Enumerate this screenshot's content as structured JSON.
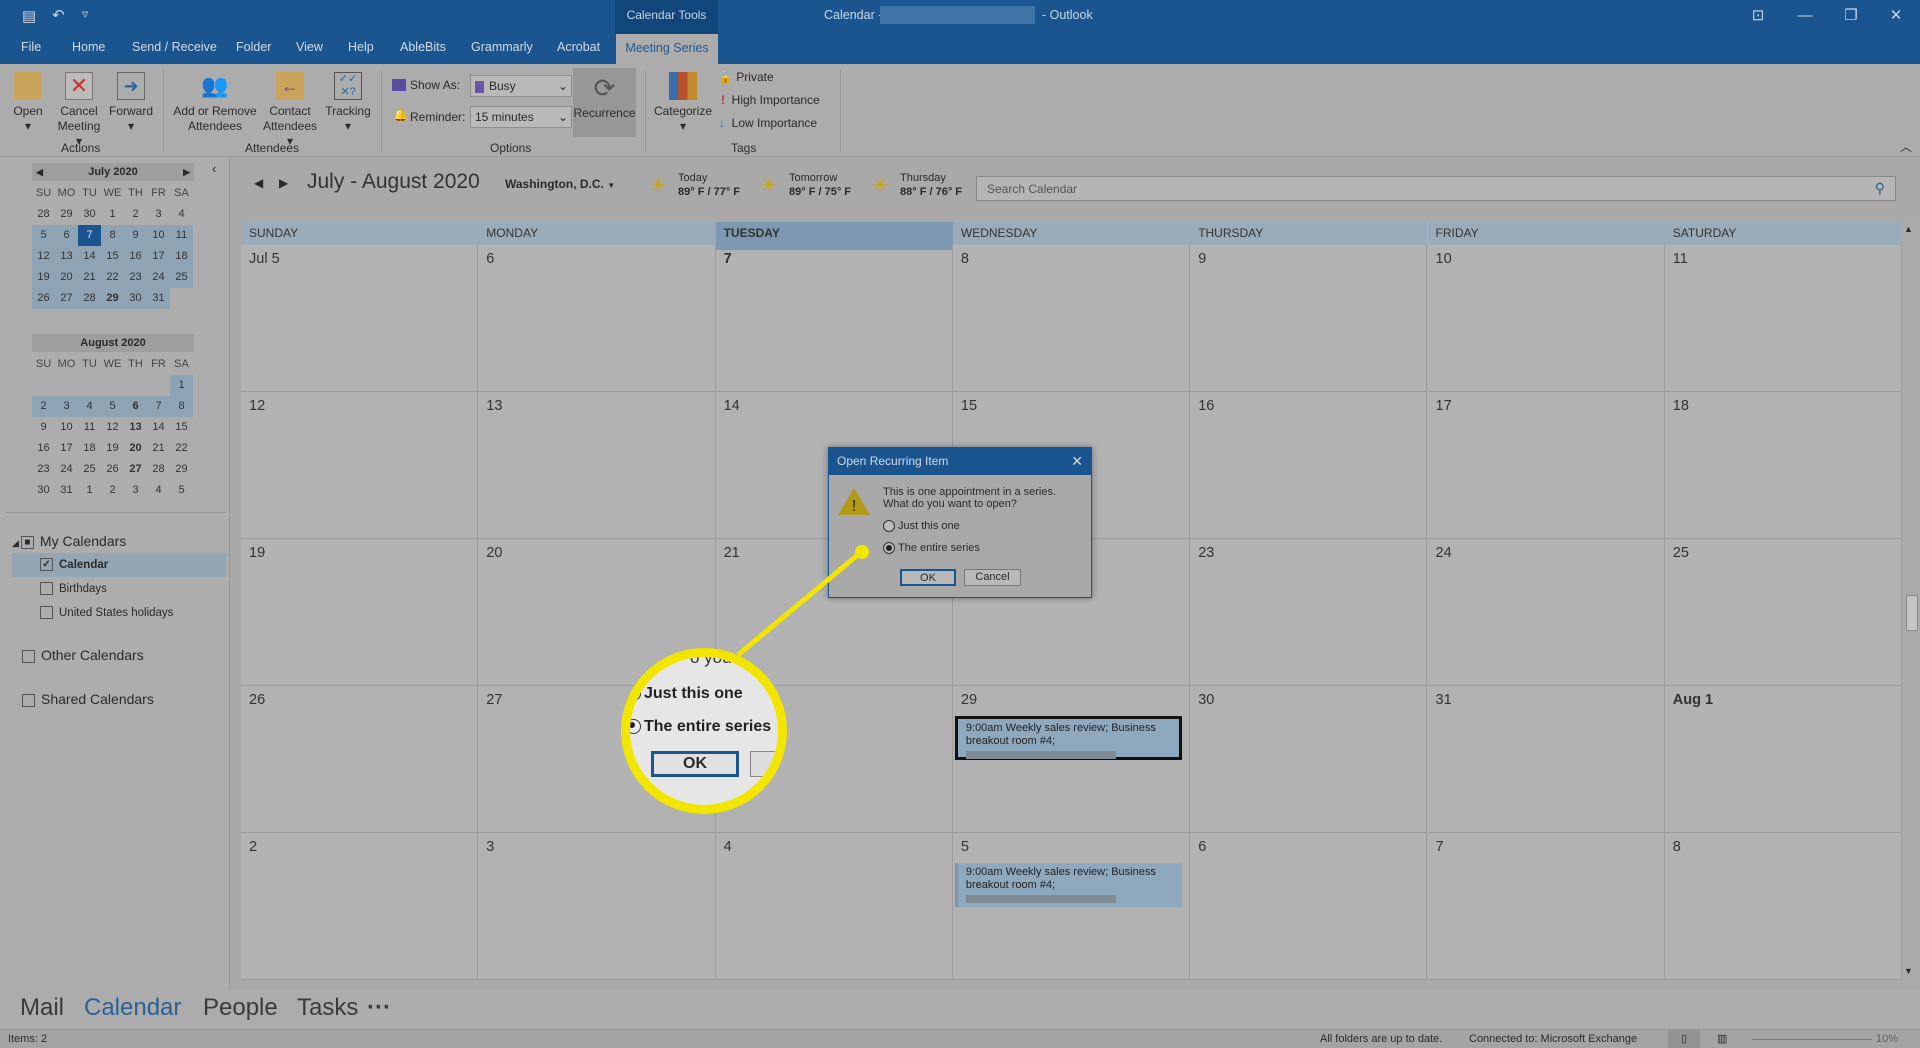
{
  "titlebar": {
    "contextual_tab": "Calendar Tools",
    "title_prefix": "Calendar -",
    "title_suffix": "- Outlook"
  },
  "tabs": [
    "File",
    "Home",
    "Send / Receive",
    "Folder",
    "View",
    "Help",
    "AbleBits",
    "Grammarly",
    "Acrobat",
    "Meeting Series"
  ],
  "ribbon": {
    "actions": {
      "open": "Open",
      "cancel1": "Cancel",
      "cancel2": "Meeting",
      "forward": "Forward",
      "group": "Actions"
    },
    "attendees": {
      "add1": "Add or Remove",
      "add2": "Attendees",
      "contact1": "Contact",
      "contact2": "Attendees",
      "tracking": "Tracking",
      "group": "Attendees"
    },
    "options": {
      "show_as_label": "Show As:",
      "show_as_value": "Busy",
      "reminder_label": "Reminder:",
      "reminder_value": "15 minutes",
      "recurrence": "Recurrence",
      "group": "Options"
    },
    "tags": {
      "categorize": "Categorize",
      "private": "Private",
      "high": "High Importance",
      "low": "Low Importance",
      "group": "Tags"
    }
  },
  "mini_calendars": [
    {
      "title": "July 2020",
      "weekdays": [
        "SU",
        "MO",
        "TU",
        "WE",
        "TH",
        "FR",
        "SA"
      ],
      "days": [
        "28",
        "29",
        "30",
        "1",
        "2",
        "3",
        "4",
        "5",
        "6",
        "7",
        "8",
        "9",
        "10",
        "11",
        "12",
        "13",
        "14",
        "15",
        "16",
        "17",
        "18",
        "19",
        "20",
        "21",
        "22",
        "23",
        "24",
        "25",
        "26",
        "27",
        "28",
        "29",
        "30",
        "31"
      ],
      "highlight_from": 7,
      "highlight_to": 33,
      "selected": 9,
      "bold": [
        31
      ]
    },
    {
      "title": "August 2020",
      "weekdays": [
        "SU",
        "MO",
        "TU",
        "WE",
        "TH",
        "FR",
        "SA"
      ],
      "days": [
        "",
        "",
        "",
        "",
        "",
        "",
        "1",
        "2",
        "3",
        "4",
        "5",
        "6",
        "7",
        "8",
        "9",
        "10",
        "11",
        "12",
        "13",
        "14",
        "15",
        "16",
        "17",
        "18",
        "19",
        "20",
        "21",
        "22",
        "23",
        "24",
        "25",
        "26",
        "27",
        "28",
        "29",
        "30",
        "31",
        "1",
        "2",
        "3",
        "4",
        "5"
      ],
      "highlight_from": 6,
      "highlight_to": 13,
      "selected": -1,
      "bold": [
        11,
        18,
        25,
        32
      ]
    }
  ],
  "calendars": {
    "my": "My Calendars",
    "items": [
      {
        "label": "Calendar",
        "checked": true
      },
      {
        "label": "Birthdays",
        "checked": false
      },
      {
        "label": "United States holidays",
        "checked": false
      }
    ],
    "other": "Other Calendars",
    "shared": "Shared Calendars"
  },
  "header": {
    "range": "July - August 2020",
    "location": "Washington, D.C.",
    "weather": [
      {
        "day": "Today",
        "temp": "89° F / 77° F"
      },
      {
        "day": "Tomorrow",
        "temp": "89° F / 75° F"
      },
      {
        "day": "Thursday",
        "temp": "88° F / 76° F"
      }
    ],
    "search_placeholder": "Search Calendar"
  },
  "weekdays": [
    "SUNDAY",
    "MONDAY",
    "TUESDAY",
    "WEDNESDAY",
    "THURSDAY",
    "FRIDAY",
    "SATURDAY"
  ],
  "today_column": 2,
  "weeks": [
    [
      "Jul 5",
      "6",
      "7",
      "8",
      "9",
      "10",
      "11"
    ],
    [
      "12",
      "13",
      "14",
      "15",
      "16",
      "17",
      "18"
    ],
    [
      "19",
      "20",
      "21",
      "22",
      "23",
      "24",
      "25"
    ],
    [
      "26",
      "27",
      "28",
      "29",
      "30",
      "31",
      "Aug 1"
    ],
    [
      "2",
      "3",
      "4",
      "5",
      "6",
      "7",
      "8"
    ]
  ],
  "bold_cells": [
    "0-2",
    "3-6"
  ],
  "events": [
    {
      "week": 3,
      "day": 3,
      "text": "9:00am Weekly sales review; Business breakout room #4;",
      "selected": true
    },
    {
      "week": 4,
      "day": 3,
      "text": "9:00am Weekly sales review; Business breakout room #4;",
      "selected": false
    }
  ],
  "dialog": {
    "title": "Open Recurring Item",
    "message1": "This is one appointment in a series.",
    "message2": "What do you want to open?",
    "option1": "Just this one",
    "option2": "The entire series",
    "selected": 2,
    "ok": "OK",
    "cancel": "Cancel"
  },
  "callout": {
    "partial": "o you",
    "option1": "Just this one",
    "option2": "The entire series",
    "ok": "OK",
    "color": "#f2e600"
  },
  "bottom_nav": [
    "Mail",
    "Calendar",
    "People",
    "Tasks",
    "···"
  ],
  "status": {
    "items": "Items: 2",
    "sync": "All folders are up to date.",
    "connection": "Connected to: Microsoft Exchange",
    "zoom": "10%"
  }
}
